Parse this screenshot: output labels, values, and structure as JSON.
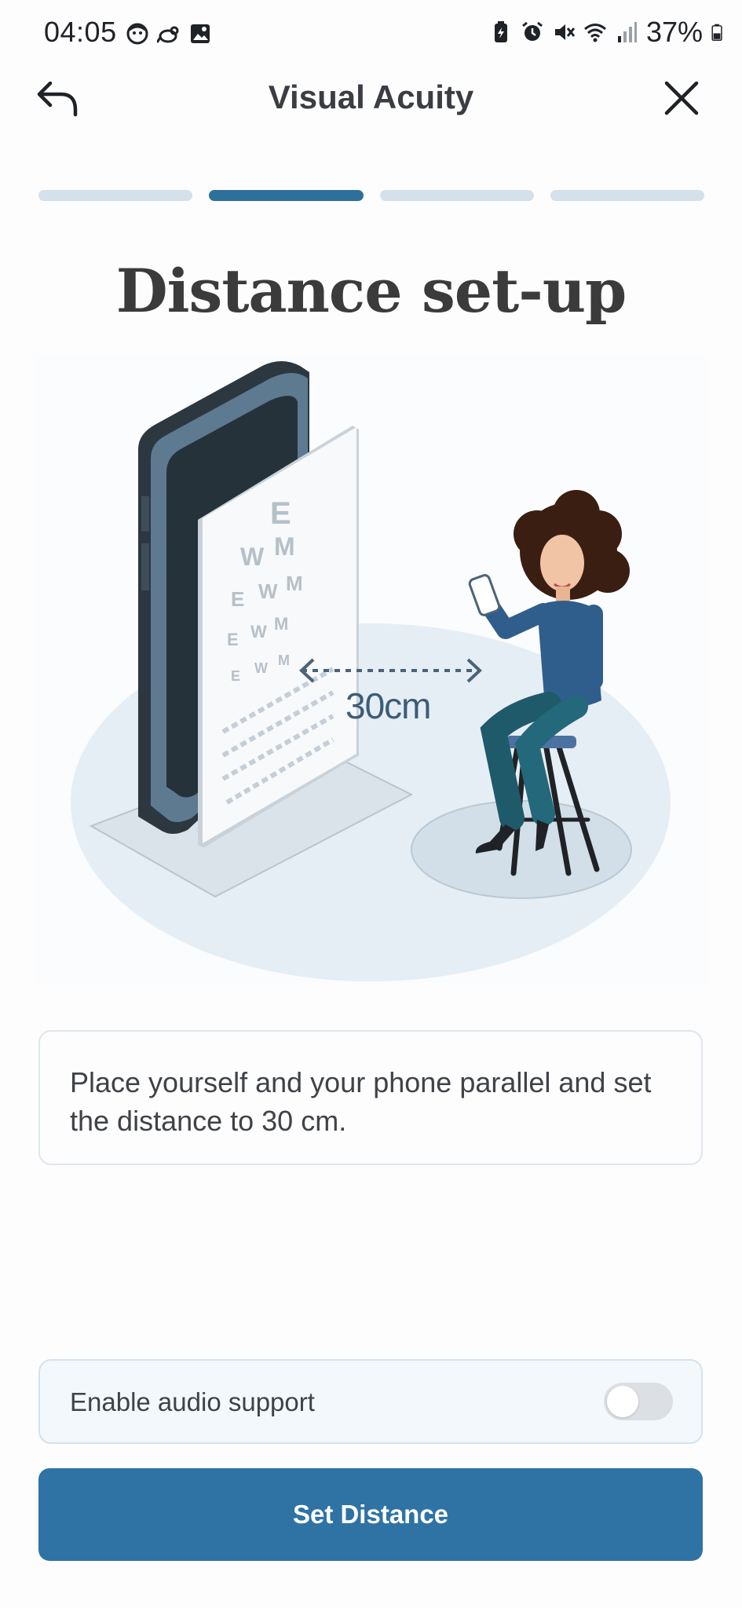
{
  "status_bar": {
    "time": "04:05",
    "battery_percent": "37%",
    "left_icons": [
      "face-icon",
      "bird-icon",
      "gallery-icon"
    ],
    "right_icons": [
      "battery-saver-icon",
      "alarm-icon",
      "mute-icon",
      "wifi-icon",
      "signal-icon",
      "battery-icon"
    ]
  },
  "header": {
    "title": "Visual Acuity",
    "back_icon": "back-arrow-icon",
    "close_icon": "close-icon"
  },
  "progress": {
    "total_steps": 4,
    "current_step": 2
  },
  "heading": "Distance set-up",
  "illustration": {
    "distance_label": "30cm",
    "eye_chart_letters": [
      "E",
      "W",
      "M",
      "E",
      "W",
      "M",
      "E",
      "W",
      "M",
      "E",
      "W",
      "M"
    ]
  },
  "instruction": {
    "text": "Place yourself and your phone parallel and set the distance to 30 cm."
  },
  "audio": {
    "label": "Enable audio support",
    "enabled": false
  },
  "primary_action": {
    "label": "Set Distance"
  },
  "colors": {
    "accent": "#2e73a4",
    "progress_active": "#2e6f9c",
    "progress_inactive": "#d5e1ea"
  }
}
